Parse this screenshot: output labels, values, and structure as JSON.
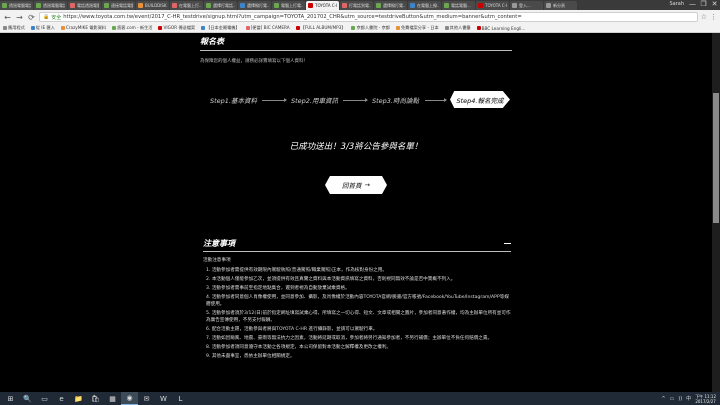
{
  "browser": {
    "tabs": [
      {
        "title": "透過電腦電話...",
        "color": "#6aa84f",
        "active": false
      },
      {
        "title": "透過電腦電話...",
        "color": "#6aa84f",
        "active": false
      },
      {
        "title": "電話透過電腦...",
        "color": "#e06666",
        "active": false
      },
      {
        "title": "連接電話電腦...",
        "color": "#6aa84f",
        "active": false
      },
      {
        "title": "BUILDDISK...",
        "color": "#e69138",
        "active": false
      },
      {
        "title": "在電腦上打...",
        "color": "#e06666",
        "active": false
      },
      {
        "title": "選擇打電話...",
        "color": "#6aa84f",
        "active": false
      },
      {
        "title": "選擇撥打電...",
        "color": "#3d85c6",
        "active": false
      },
      {
        "title": "電腦上打電...",
        "color": "#6aa84f",
        "active": false
      },
      {
        "title": "TOYOTA C-HR",
        "color": "#cc0000",
        "active": true
      },
      {
        "title": "打電話到電...",
        "color": "#e06666",
        "active": false
      },
      {
        "title": "選擇撥打電...",
        "color": "#6aa84f",
        "active": false
      },
      {
        "title": "在電腦上撥...",
        "color": "#3d85c6",
        "active": false
      },
      {
        "title": "電話電腦...",
        "color": "#6aa84f",
        "active": false
      },
      {
        "title": "TOYOTA C-HR",
        "color": "#cc0000",
        "active": false
      },
      {
        "title": "登入...",
        "color": "#999999",
        "active": false
      },
      {
        "title": "新分頁",
        "color": "#999999",
        "active": false
      }
    ],
    "user": "Sarah",
    "window_buttons": [
      "—",
      "❐",
      "✕"
    ],
    "nav": {
      "back": "←",
      "forward": "→",
      "reload": "⟳"
    },
    "security_label": "安全",
    "url": "https://www.toyota.com.tw/event/2017_C-HR_testdrive/signup.html?utm_campaign=TOYOTA_201702_CHR&utm_source=testdriveButton&utm_medium=banner&utm_content=",
    "omni_icons": [
      "☆",
      "⋮"
    ],
    "bookmarks": [
      {
        "label": "應用程式",
        "color": "#888888"
      },
      {
        "label": "從 IE 匯入",
        "color": "#3d85c6"
      },
      {
        "label": "CrazyMIKE 電影資料",
        "color": "#e69138"
      },
      {
        "label": "痞客.com - 新生活",
        "color": "#6aa84f"
      },
      {
        "label": "VIGOR 傳送檔案",
        "color": "#cc0000"
      },
      {
        "label": "【日本金屬電機】",
        "color": "#3d85c6"
      },
      {
        "label": "[便當] BIC CAMERA",
        "color": "#e06666"
      },
      {
        "label": "【FULL ALBUM/MP3】",
        "color": "#cc0000"
      },
      {
        "label": "京都人書院 - 京都",
        "color": "#6aa84f"
      },
      {
        "label": "免費檔案分享 - 日本",
        "color": "#e69138"
      },
      {
        "label": "其他人書籤",
        "color": "#888888"
      },
      {
        "label": "BBC Learning Engli...",
        "color": "#cc0000"
      }
    ]
  },
  "page": {
    "form_title": "報名表",
    "form_desc": "為保障您的個人權益，請務必詳實填寫以下個人資料！",
    "steps": [
      {
        "label": "Step1.基本資料"
      },
      {
        "label": "Step2.用車資訊"
      },
      {
        "label": "Step3.時尚論點"
      }
    ],
    "active_step": "Step4.報名完成",
    "success_message": "已成功送出！3/3將公告參與名單！",
    "home_button": "回首頁",
    "home_arrow": "→",
    "notes_title": "注意事項",
    "notes_toggle": "—",
    "notes_heading": "活動注意事項",
    "notes": [
      "1. 活動參加者需提供有效期限內駕駛執照(普通駕照/職業駕照)正本，作為核對身份之用。",
      "2. 本活動個人僅能參加乙次，並須提供有效且真實之資料與本活動資訊填寫之資料，否則視同無效不論是否中獎概不列入。",
      "3. 活動參加者需事前至指定地點集合，遲到者視為自動放棄試乘資格。",
      "4. 活動參加者同意個人肖像權使用，並同意參加、攝影，及肖像權於活動內容TOYOTA官網/臉書/官方帳號/Facebook/YouTube/Instagram/APP等媒體使用。",
      "5. 活動參加者須於3/12(日)前於指定網址填寫試乘心得，所填寫之一切心得、短文、文章或相關之圖片，參加者同意著作權，均為主辦單位所有並可作為廣告宣傳使用，不另支付報酬。",
      "6. 配合活動主題，活動參與者將與TOYOTA C-HR 進行攝錄影，並請可以駕駛行車。",
      "7. 活動如因颱風、地震、豪雨等無法抗力之因素，活動將延期或取消，參加者將另行通知參加者，不另行補償；主辦單位不負任何賠償之責。",
      "8. 活動參加者須同意遵守本活動之各項規定，本公司保留對本活動之解釋權及更改之權利。",
      "9. 其他未盡事宜，悉依主辦單位相關規定。"
    ]
  },
  "taskbar": {
    "items": [
      {
        "icon": "⊞",
        "name": "start"
      },
      {
        "icon": "🔍",
        "name": "search"
      },
      {
        "icon": "▭",
        "name": "task-view"
      },
      {
        "icon": "e",
        "name": "edge"
      },
      {
        "icon": "📁",
        "name": "explorer"
      },
      {
        "icon": "🛍",
        "name": "store"
      },
      {
        "icon": "▦",
        "name": "calculator"
      },
      {
        "icon": "◉",
        "name": "chrome"
      },
      {
        "icon": "✉",
        "name": "mail"
      },
      {
        "icon": "W",
        "name": "word"
      },
      {
        "icon": "L",
        "name": "line"
      }
    ],
    "active_index": 7,
    "tray_icons": [
      "^",
      "▭",
      "))",
      "中"
    ],
    "time": "下午 11:12",
    "date": "2017/2/27"
  }
}
